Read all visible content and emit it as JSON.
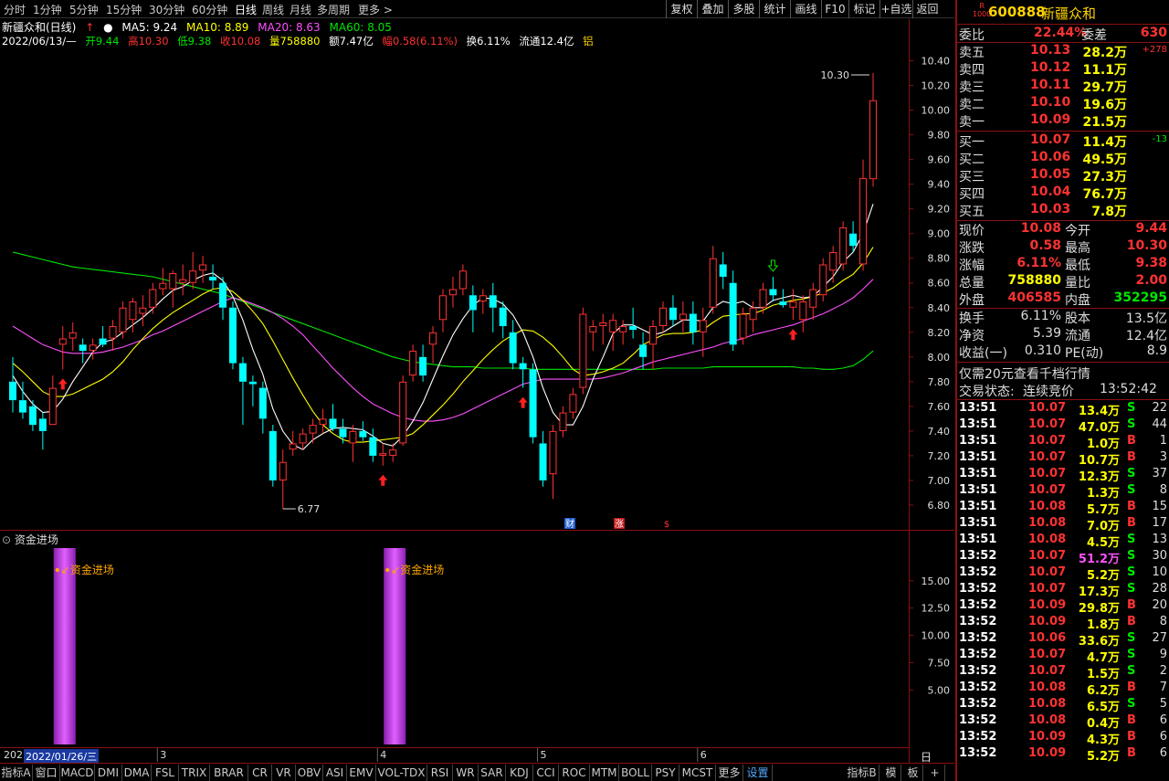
{
  "toolbar": {
    "periods": [
      "分时",
      "1分钟",
      "5分钟",
      "15分钟",
      "30分钟",
      "60分钟",
      "日线",
      "周线",
      "月线",
      "多周期",
      "更多 >"
    ],
    "active_period": "日线",
    "buttons": [
      "复权",
      "叠加",
      "多股",
      "统计",
      "画线",
      "F10",
      "标记",
      "+自选",
      "返回"
    ]
  },
  "header": {
    "title": "新疆众和(日线)",
    "ma5": "MA5: 9.24",
    "ma10": "MA10: 8.89",
    "ma20": "MA20: 8.63",
    "ma60": "MA60: 8.05",
    "date": "2022/06/13/—",
    "open": "开9.44",
    "high": "高10.30",
    "low": "低9.38",
    "close": "收10.08",
    "volume": "量758880",
    "amount": "额7.47亿",
    "range": "幅0.58(6.11%)",
    "turnover": "换6.11%",
    "float": "流通12.4亿",
    "extra": "铝"
  },
  "colors": {
    "up": "#ff3232",
    "down": "#00ffff",
    "ma5": "#ffffff",
    "ma10": "#ffff00",
    "ma20": "#ff50ff",
    "ma60": "#00e600",
    "fund_bar": "#c040e0",
    "frame": "#8a1010"
  },
  "chart_data": {
    "type": "candlestick",
    "title": "新疆众和(日线)",
    "ylim": [
      6.6,
      10.5
    ],
    "y_ticks": [
      "10.40",
      "10.20",
      "10.00",
      "9.80",
      "9.60",
      "9.40",
      "9.20",
      "9.00",
      "8.80",
      "8.60",
      "8.40",
      "8.20",
      "8.00",
      "7.80",
      "7.60",
      "7.40",
      "7.20",
      "7.00",
      "6.80"
    ],
    "annotations": {
      "high_label": "10.30",
      "low_label": "6.77"
    },
    "event_marks": [
      "财",
      "涨",
      "$"
    ],
    "candles": [
      [
        7.8,
        8.0,
        7.55,
        7.65
      ],
      [
        7.65,
        7.8,
        7.5,
        7.55
      ],
      [
        7.6,
        7.65,
        7.4,
        7.45
      ],
      [
        7.5,
        7.55,
        7.25,
        7.4
      ],
      [
        7.45,
        7.85,
        7.45,
        7.75
      ],
      [
        8.1,
        8.25,
        7.9,
        8.15
      ],
      [
        8.15,
        8.28,
        8.05,
        8.2
      ],
      [
        8.1,
        8.15,
        7.95,
        8.05
      ],
      [
        8.05,
        8.15,
        7.98,
        8.1
      ],
      [
        8.15,
        8.25,
        8.08,
        8.1
      ],
      [
        8.15,
        8.3,
        8.05,
        8.25
      ],
      [
        8.2,
        8.45,
        8.15,
        8.4
      ],
      [
        8.3,
        8.48,
        8.2,
        8.45
      ],
      [
        8.35,
        8.5,
        8.25,
        8.4
      ],
      [
        8.4,
        8.6,
        8.35,
        8.55
      ],
      [
        8.55,
        8.72,
        8.5,
        8.6
      ],
      [
        8.55,
        8.7,
        8.4,
        8.68
      ],
      [
        8.6,
        8.75,
        8.5,
        8.63
      ],
      [
        8.6,
        8.85,
        8.55,
        8.7
      ],
      [
        8.7,
        8.82,
        8.6,
        8.75
      ],
      [
        8.65,
        8.75,
        8.55,
        8.62
      ],
      [
        8.6,
        8.65,
        8.3,
        8.4
      ],
      [
        8.4,
        8.45,
        7.9,
        7.95
      ],
      [
        7.95,
        8.0,
        7.45,
        7.8
      ],
      [
        7.8,
        7.85,
        7.6,
        7.78
      ],
      [
        7.75,
        7.8,
        7.38,
        7.5
      ],
      [
        7.4,
        7.45,
        6.95,
        7.0
      ],
      [
        7.0,
        7.25,
        6.77,
        7.15
      ],
      [
        7.25,
        7.4,
        7.2,
        7.3
      ],
      [
        7.3,
        7.42,
        7.25,
        7.38
      ],
      [
        7.38,
        7.5,
        7.3,
        7.45
      ],
      [
        7.45,
        7.58,
        7.38,
        7.5
      ],
      [
        7.5,
        7.62,
        7.4,
        7.42
      ],
      [
        7.42,
        7.5,
        7.3,
        7.35
      ],
      [
        7.3,
        7.45,
        7.15,
        7.4
      ],
      [
        7.4,
        7.48,
        7.32,
        7.35
      ],
      [
        7.35,
        7.42,
        7.15,
        7.2
      ],
      [
        7.2,
        7.3,
        7.12,
        7.22
      ],
      [
        7.2,
        7.3,
        7.15,
        7.25
      ],
      [
        7.3,
        7.85,
        7.28,
        7.8
      ],
      [
        7.85,
        8.1,
        7.8,
        8.05
      ],
      [
        8.0,
        8.1,
        7.8,
        7.85
      ],
      [
        8.1,
        8.25,
        7.95,
        8.2
      ],
      [
        8.3,
        8.55,
        8.2,
        8.5
      ],
      [
        8.5,
        8.65,
        8.4,
        8.55
      ],
      [
        8.55,
        8.75,
        8.5,
        8.7
      ],
      [
        8.5,
        8.58,
        8.2,
        8.38
      ],
      [
        8.45,
        8.55,
        8.35,
        8.5
      ],
      [
        8.5,
        8.6,
        8.2,
        8.4
      ],
      [
        8.4,
        8.45,
        8.15,
        8.25
      ],
      [
        8.2,
        8.3,
        7.9,
        7.95
      ],
      [
        7.95,
        8.0,
        7.75,
        7.9
      ],
      [
        7.9,
        7.95,
        7.3,
        7.35
      ],
      [
        7.3,
        7.4,
        6.95,
        7.0
      ],
      [
        7.05,
        7.45,
        6.85,
        7.4
      ],
      [
        7.4,
        7.6,
        7.35,
        7.55
      ],
      [
        7.55,
        7.75,
        7.5,
        7.7
      ],
      [
        7.75,
        8.4,
        7.7,
        8.35
      ],
      [
        8.2,
        8.3,
        8.05,
        8.25
      ],
      [
        8.25,
        8.35,
        8.1,
        8.28
      ],
      [
        8.2,
        8.35,
        8.05,
        8.3
      ],
      [
        8.2,
        8.3,
        8.1,
        8.25
      ],
      [
        8.25,
        8.4,
        8.15,
        8.22
      ],
      [
        8.1,
        8.2,
        7.9,
        8.0
      ],
      [
        8.1,
        8.3,
        7.9,
        8.25
      ],
      [
        8.25,
        8.45,
        8.2,
        8.4
      ],
      [
        8.4,
        8.5,
        8.25,
        8.3
      ],
      [
        8.3,
        8.45,
        8.2,
        8.35
      ],
      [
        8.35,
        8.45,
        8.1,
        8.2
      ],
      [
        8.2,
        8.4,
        8.0,
        8.3
      ],
      [
        8.4,
        8.9,
        8.35,
        8.8
      ],
      [
        8.75,
        8.85,
        8.55,
        8.65
      ],
      [
        8.6,
        8.7,
        8.05,
        8.1
      ],
      [
        8.15,
        8.4,
        8.1,
        8.35
      ],
      [
        8.3,
        8.45,
        8.2,
        8.4
      ],
      [
        8.4,
        8.6,
        8.35,
        8.55
      ],
      [
        8.55,
        8.65,
        8.45,
        8.5
      ],
      [
        8.45,
        8.55,
        8.4,
        8.42
      ],
      [
        8.4,
        8.55,
        8.3,
        8.45
      ],
      [
        8.3,
        8.5,
        8.2,
        8.45
      ],
      [
        8.4,
        8.6,
        8.3,
        8.55
      ],
      [
        8.5,
        8.8,
        8.45,
        8.75
      ],
      [
        8.7,
        8.9,
        8.6,
        8.85
      ],
      [
        8.75,
        9.1,
        8.7,
        9.05
      ],
      [
        9.0,
        9.1,
        8.85,
        8.9
      ],
      [
        8.75,
        9.6,
        8.7,
        9.45
      ],
      [
        9.44,
        10.3,
        9.38,
        10.08
      ]
    ],
    "ma5": [
      7.85,
      7.72,
      7.62,
      7.55,
      7.56,
      7.66,
      7.8,
      7.92,
      8.04,
      8.12,
      8.14,
      8.2,
      8.26,
      8.32,
      8.39,
      8.47,
      8.54,
      8.57,
      8.62,
      8.66,
      8.68,
      8.62,
      8.49,
      8.3,
      8.06,
      7.86,
      7.58,
      7.4,
      7.29,
      7.25,
      7.33,
      7.38,
      7.42,
      7.43,
      7.42,
      7.41,
      7.36,
      7.3,
      7.28,
      7.36,
      7.48,
      7.63,
      7.82,
      8.01,
      8.18,
      8.31,
      8.42,
      8.48,
      8.47,
      8.43,
      8.34,
      8.2,
      8.0,
      7.75,
      7.55,
      7.45,
      7.45,
      7.6,
      7.82,
      8.0,
      8.19,
      8.26,
      8.26,
      8.22,
      8.18,
      8.2,
      8.25,
      8.3,
      8.3,
      8.29,
      8.4,
      8.45,
      8.43,
      8.45,
      8.4,
      8.4,
      8.46,
      8.48,
      8.5,
      8.48,
      8.49,
      8.57,
      8.65,
      8.77,
      8.85,
      9.0,
      9.24
    ],
    "ma10": [
      7.95,
      7.88,
      7.8,
      7.72,
      7.68,
      7.68,
      7.7,
      7.74,
      7.78,
      7.82,
      7.88,
      7.96,
      8.06,
      8.15,
      8.23,
      8.3,
      8.36,
      8.41,
      8.46,
      8.51,
      8.55,
      8.56,
      8.53,
      8.46,
      8.37,
      8.27,
      8.13,
      7.98,
      7.83,
      7.69,
      7.56,
      7.45,
      7.38,
      7.33,
      7.31,
      7.31,
      7.32,
      7.33,
      7.34,
      7.35,
      7.38,
      7.45,
      7.53,
      7.61,
      7.7,
      7.8,
      7.89,
      7.98,
      8.06,
      8.13,
      8.18,
      8.22,
      8.21,
      8.16,
      8.09,
      8.0,
      7.9,
      7.85,
      7.86,
      7.88,
      7.91,
      7.95,
      8.02,
      8.1,
      8.14,
      8.18,
      8.19,
      8.19,
      8.2,
      8.22,
      8.28,
      8.33,
      8.34,
      8.35,
      8.35,
      8.38,
      8.42,
      8.44,
      8.46,
      8.47,
      8.49,
      8.52,
      8.56,
      8.62,
      8.67,
      8.76,
      8.89
    ],
    "ma20": [
      8.25,
      8.2,
      8.15,
      8.1,
      8.07,
      8.04,
      8.03,
      8.03,
      8.03,
      8.04,
      8.06,
      8.08,
      8.11,
      8.14,
      8.18,
      8.21,
      8.25,
      8.29,
      8.33,
      8.37,
      8.41,
      8.45,
      8.48,
      8.46,
      8.43,
      8.4,
      8.36,
      8.31,
      8.25,
      8.18,
      8.09,
      8.0,
      7.91,
      7.83,
      7.75,
      7.68,
      7.62,
      7.58,
      7.54,
      7.51,
      7.49,
      7.48,
      7.48,
      7.49,
      7.51,
      7.54,
      7.58,
      7.62,
      7.66,
      7.7,
      7.74,
      7.78,
      7.8,
      7.82,
      7.82,
      7.82,
      7.82,
      7.82,
      7.82,
      7.83,
      7.85,
      7.87,
      7.9,
      7.93,
      7.96,
      7.98,
      8.0,
      8.02,
      8.04,
      8.06,
      8.08,
      8.11,
      8.13,
      8.15,
      8.18,
      8.2,
      8.22,
      8.24,
      8.26,
      8.29,
      8.32,
      8.35,
      8.39,
      8.43,
      8.48,
      8.55,
      8.63
    ],
    "ma60": [
      8.85,
      8.83,
      8.81,
      8.79,
      8.77,
      8.75,
      8.73,
      8.72,
      8.71,
      8.7,
      8.69,
      8.68,
      8.67,
      8.66,
      8.65,
      8.63,
      8.61,
      8.59,
      8.57,
      8.55,
      8.53,
      8.51,
      8.48,
      8.45,
      8.42,
      8.39,
      8.36,
      8.33,
      8.3,
      8.27,
      8.24,
      8.21,
      8.18,
      8.15,
      8.12,
      8.09,
      8.06,
      8.03,
      8.0,
      7.98,
      7.96,
      7.95,
      7.94,
      7.93,
      7.92,
      7.92,
      7.92,
      7.91,
      7.91,
      7.91,
      7.91,
      7.91,
      7.9,
      7.9,
      7.9,
      7.9,
      7.9,
      7.9,
      7.9,
      7.9,
      7.9,
      7.9,
      7.9,
      7.9,
      7.9,
      7.91,
      7.91,
      7.91,
      7.91,
      7.91,
      7.92,
      7.92,
      7.92,
      7.92,
      7.92,
      7.92,
      7.92,
      7.92,
      7.92,
      7.91,
      7.91,
      7.9,
      7.9,
      7.91,
      7.93,
      7.98,
      8.05
    ],
    "buy_arrow_indices": [
      5,
      37,
      51,
      78
    ],
    "sell_arrow_indices": [
      76
    ]
  },
  "fund_panel": {
    "title": "资金进场",
    "label": "资金进场",
    "ylim": [
      0,
      18
    ],
    "y_ticks": [
      "15.00",
      "12.50",
      "10.00",
      "7.50",
      "5.00"
    ],
    "bars": [
      {
        "index": 5,
        "value": 18
      },
      {
        "index": 38,
        "value": 18
      }
    ]
  },
  "date_axis": {
    "year_prefix": "202",
    "cursor_date": "2022/01/26/三",
    "month_marks": [
      {
        "label": "3",
        "index": 15
      },
      {
        "label": "4",
        "index": 37
      },
      {
        "label": "5",
        "index": 53
      },
      {
        "label": "6",
        "index": 69
      }
    ]
  },
  "bottom_tabs": [
    "指标A",
    "窗口",
    "MACD",
    "DMI",
    "DMA",
    "FSL",
    "TRIX",
    "BRAR",
    "CR",
    "VR",
    "OBV",
    "ASI",
    "EMV",
    "VOL-TDX",
    "RSI",
    "WR",
    "SAR",
    "KDJ",
    "CCI",
    "ROC",
    "MTM",
    "BOLL",
    "PSY",
    "MCST",
    "更多",
    "设置"
  ],
  "bottom_right_tabs": [
    "指标B",
    "模",
    "板",
    "+",
    "-"
  ],
  "bottom_right_label": "日线",
  "stock": {
    "code": "600888",
    "name": "新疆众和",
    "weibi_label": "委比",
    "weibi_value": "22.44%",
    "weicha_label": "委差",
    "weicha_value": "630",
    "sells": [
      {
        "label": "卖五",
        "price": "10.13",
        "vol": "28.2万",
        "chg": "+278"
      },
      {
        "label": "卖四",
        "price": "10.12",
        "vol": "11.1万",
        "chg": ""
      },
      {
        "label": "卖三",
        "price": "10.11",
        "vol": "29.7万",
        "chg": ""
      },
      {
        "label": "卖二",
        "price": "10.10",
        "vol": "19.6万",
        "chg": ""
      },
      {
        "label": "卖一",
        "price": "10.09",
        "vol": "21.5万",
        "chg": ""
      }
    ],
    "buys": [
      {
        "label": "买一",
        "price": "10.07",
        "vol": "11.4万",
        "chg": "-13"
      },
      {
        "label": "买二",
        "price": "10.06",
        "vol": "49.5万",
        "chg": ""
      },
      {
        "label": "买三",
        "price": "10.05",
        "vol": "27.3万",
        "chg": ""
      },
      {
        "label": "买四",
        "price": "10.04",
        "vol": "76.7万",
        "chg": ""
      },
      {
        "label": "买五",
        "price": "10.03",
        "vol": "7.8万",
        "chg": ""
      }
    ],
    "quote": [
      {
        "l1": "现价",
        "v1": "10.08",
        "l2": "今开",
        "v2": "9.44",
        "c1": "red",
        "c2": "red"
      },
      {
        "l1": "涨跌",
        "v1": "0.58",
        "l2": "最高",
        "v2": "10.30",
        "c1": "red",
        "c2": "red"
      },
      {
        "l1": "涨幅",
        "v1": "6.11%",
        "l2": "最低",
        "v2": "9.38",
        "c1": "red",
        "c2": "red"
      },
      {
        "l1": "总量",
        "v1": "758880",
        "l2": "量比",
        "v2": "2.00",
        "c1": "yellow",
        "c2": "red"
      },
      {
        "l1": "外盘",
        "v1": "406585",
        "l2": "内盘",
        "v2": "352295",
        "c1": "red",
        "c2": "green"
      }
    ],
    "stats": [
      {
        "l1": "换手",
        "v1": "6.11%",
        "l2": "股本",
        "v2": "13.5亿"
      },
      {
        "l1": "净资",
        "v1": "5.39",
        "l2": "流通",
        "v2": "12.4亿"
      },
      {
        "l1": "收益(一)",
        "v1": "0.310",
        "l2": "PE(动)",
        "v2": "8.9"
      }
    ],
    "promo": "仅需20元查看千档行情",
    "status_label": "交易状态:",
    "status_value": "连续竞价",
    "status_time": "13:52:42"
  },
  "trades": [
    {
      "t": "13:51",
      "p": "10.07",
      "v": "13.4万",
      "s": "S",
      "n": "22",
      "pc": "red",
      "vc": "yellow"
    },
    {
      "t": "13:51",
      "p": "10.07",
      "v": "47.0万",
      "s": "S",
      "n": "44",
      "pc": "red",
      "vc": "yellow"
    },
    {
      "t": "13:51",
      "p": "10.07",
      "v": "1.0万",
      "s": "B",
      "n": "1",
      "pc": "red",
      "vc": "yellow"
    },
    {
      "t": "13:51",
      "p": "10.07",
      "v": "10.7万",
      "s": "B",
      "n": "3",
      "pc": "red",
      "vc": "yellow"
    },
    {
      "t": "13:51",
      "p": "10.07",
      "v": "12.3万",
      "s": "S",
      "n": "37",
      "pc": "red",
      "vc": "yellow"
    },
    {
      "t": "13:51",
      "p": "10.07",
      "v": "1.3万",
      "s": "S",
      "n": "8",
      "pc": "red",
      "vc": "yellow"
    },
    {
      "t": "13:51",
      "p": "10.08",
      "v": "5.7万",
      "s": "B",
      "n": "15",
      "pc": "red",
      "vc": "yellow"
    },
    {
      "t": "13:51",
      "p": "10.08",
      "v": "7.0万",
      "s": "B",
      "n": "17",
      "pc": "red",
      "vc": "yellow"
    },
    {
      "t": "13:51",
      "p": "10.08",
      "v": "4.5万",
      "s": "S",
      "n": "13",
      "pc": "red",
      "vc": "yellow"
    },
    {
      "t": "13:52",
      "p": "10.07",
      "v": "51.2万",
      "s": "S",
      "n": "30",
      "pc": "red",
      "vc": "mag"
    },
    {
      "t": "13:52",
      "p": "10.07",
      "v": "5.2万",
      "s": "S",
      "n": "10",
      "pc": "red",
      "vc": "yellow"
    },
    {
      "t": "13:52",
      "p": "10.07",
      "v": "17.3万",
      "s": "S",
      "n": "28",
      "pc": "red",
      "vc": "yellow"
    },
    {
      "t": "13:52",
      "p": "10.09",
      "v": "29.8万",
      "s": "B",
      "n": "20",
      "pc": "red",
      "vc": "yellow"
    },
    {
      "t": "13:52",
      "p": "10.09",
      "v": "1.8万",
      "s": "B",
      "n": "8",
      "pc": "red",
      "vc": "yellow"
    },
    {
      "t": "13:52",
      "p": "10.06",
      "v": "33.6万",
      "s": "S",
      "n": "27",
      "pc": "red",
      "vc": "yellow"
    },
    {
      "t": "13:52",
      "p": "10.07",
      "v": "4.7万",
      "s": "S",
      "n": "9",
      "pc": "red",
      "vc": "yellow"
    },
    {
      "t": "13:52",
      "p": "10.07",
      "v": "1.5万",
      "s": "S",
      "n": "2",
      "pc": "red",
      "vc": "yellow"
    },
    {
      "t": "13:52",
      "p": "10.08",
      "v": "6.2万",
      "s": "B",
      "n": "7",
      "pc": "red",
      "vc": "yellow"
    },
    {
      "t": "13:52",
      "p": "10.08",
      "v": "6.5万",
      "s": "S",
      "n": "5",
      "pc": "red",
      "vc": "yellow"
    },
    {
      "t": "13:52",
      "p": "10.08",
      "v": "0.4万",
      "s": "B",
      "n": "6",
      "pc": "red",
      "vc": "yellow"
    },
    {
      "t": "13:52",
      "p": "10.09",
      "v": "4.3万",
      "s": "B",
      "n": "6",
      "pc": "red",
      "vc": "yellow"
    },
    {
      "t": "13:52",
      "p": "10.09",
      "v": "5.2万",
      "s": "B",
      "n": "6",
      "pc": "red",
      "vc": "yellow"
    }
  ]
}
